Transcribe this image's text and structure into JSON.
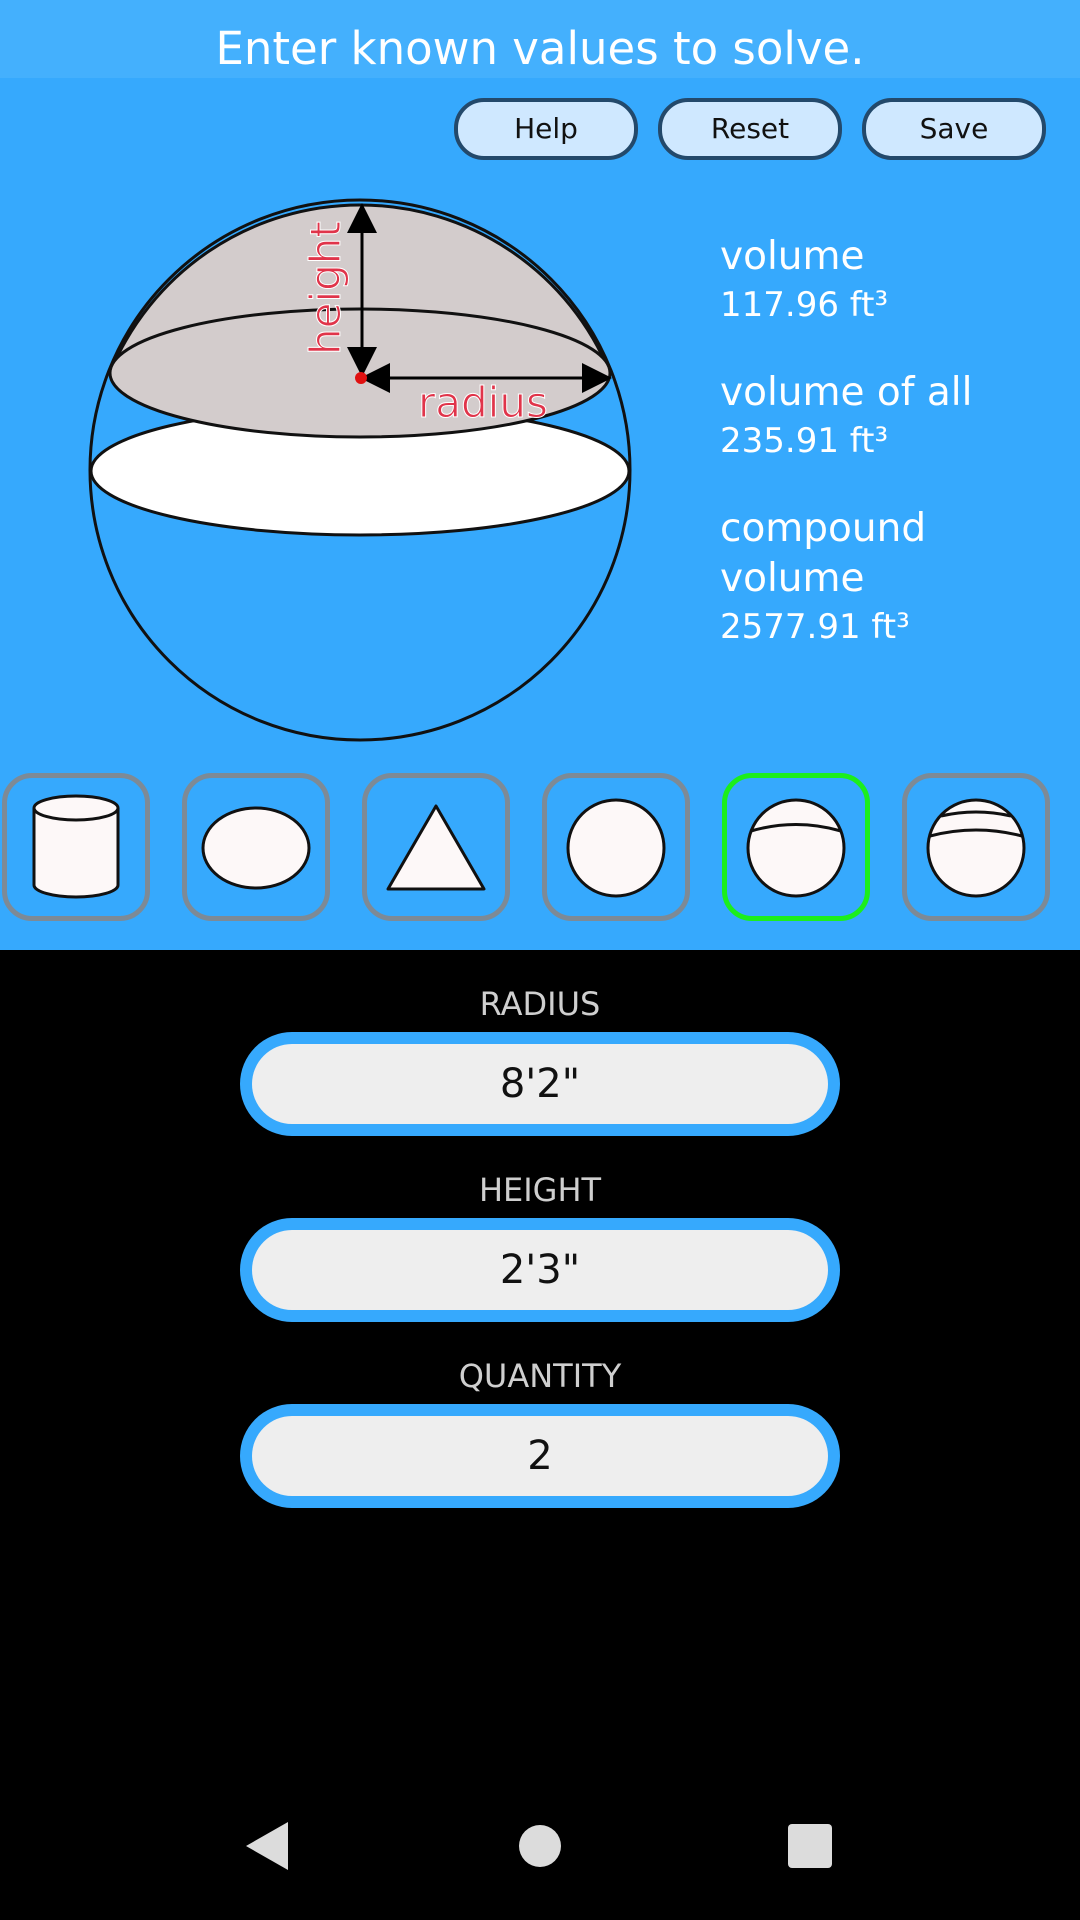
{
  "header": {
    "title": "Enter known values to solve."
  },
  "toolbar": {
    "help_label": "Help",
    "reset_label": "Reset",
    "save_label": "Save"
  },
  "diagram": {
    "height_label": "height",
    "radius_label": "radius"
  },
  "results": [
    {
      "label": "volume",
      "value": "117.96 ft³"
    },
    {
      "label": "volume of all",
      "value": "235.91 ft³"
    },
    {
      "label": "compound volume",
      "value": "2577.91 ft³"
    }
  ],
  "shapes": [
    {
      "icon": "cylinder-icon",
      "selected": false
    },
    {
      "icon": "ellipse-icon",
      "selected": false
    },
    {
      "icon": "cone-icon",
      "selected": false
    },
    {
      "icon": "sphere-icon",
      "selected": false
    },
    {
      "icon": "spherical-cap-icon",
      "selected": true
    },
    {
      "icon": "spherical-segment-icon",
      "selected": false
    }
  ],
  "fields": {
    "radius": {
      "label": "RADIUS",
      "value": "8'2\""
    },
    "height": {
      "label": "HEIGHT",
      "value": "2'3\""
    },
    "quantity": {
      "label": "QUANTITY",
      "value": "2"
    }
  },
  "colors": {
    "panel": "#36a9fd",
    "selected_border": "#1cee1c",
    "label_red": "#e0344a"
  }
}
